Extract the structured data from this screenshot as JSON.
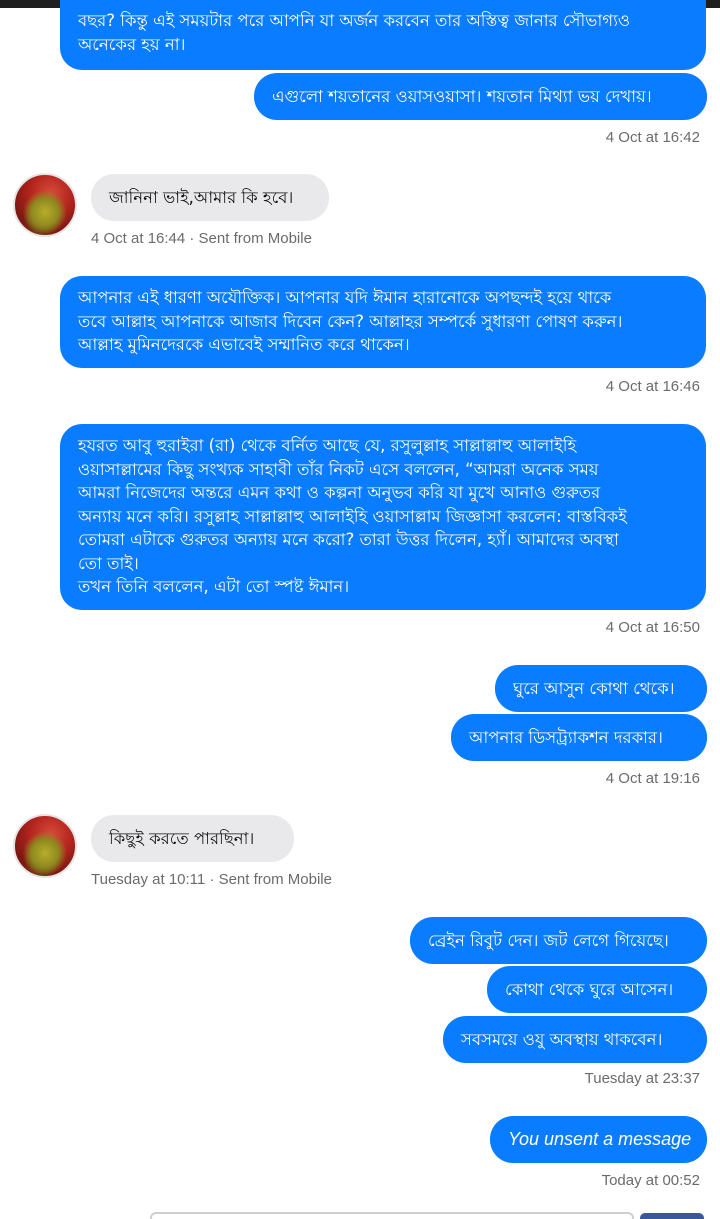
{
  "messages": {
    "m1": "বছর? কিন্তু এই সময়টার পরে আপনি যা অর্জন করবেন তার অস্তিত্ব জানার সৌভাগ্যও\nঅনেকের হয় না।",
    "m2": "এগুলো শয়তানের ওয়াসওয়াসা। শয়তান মিথ্যা ভয় দেখায়।",
    "t1": "4 Oct at 16:42",
    "r1": "জানিনা ভাই,আমার কি হবে।",
    "t2": "4 Oct at 16:44 · Sent from Mobile",
    "m3": "আপনার এই ধারণা অযৌক্তিক। আপনার যদি ঈমান হারানোকে অপছন্দই হয়ে থাকে\nতবে আল্লাহ আপনাকে আজাব দিবেন কেন? আল্লাহর সম্পর্কে সুধারণা পোষণ করুন।\nআল্লাহ মুমিনদেরকে এভাবেই সম্মানিত করে থাকেন।",
    "t3": "4 Oct at 16:46",
    "m4": "হযরত আবু হুরাইরা (রা) থেকে বর্নিত আছে যে, রসুলুল্লাহ সাল্লাল্লাহু আলাইহি\nওয়াসাল্লামের কিছু সংখ্যক সাহাবী তাঁর নিকট এসে বললেন, “আমরা অনেক সময়\nআমরা নিজেদের অন্তরে এমন কথা ও কল্পনা অনুভব করি যা মুখে আনাও গুরুতর\nঅন্যায় মনে করি। রসুল্লাহ সাল্লাল্লাহু আলাইহি ওয়াসাল্লাম জিজ্ঞাসা করলেন: বাস্তবিকই\nতোমরা এটাকে গুরুতর অন্যায় মনে করো? তারা উত্তর দিলেন, হ্যাঁ। আমাদের অবস্থা\nতো তাই।\n তখন তিনি বললেন, এটা তো স্পষ্ট ঈমান।",
    "t4": "4 Oct at 16:50",
    "m5": "ঘুরে আসুন কোথা থেকে।",
    "m6": "আপনার ডিসট্র্যাকশন দরকার।",
    "t5": "4 Oct at 19:16",
    "r2": "কিছুই করতে পারছিনা।",
    "t6": "Tuesday at 10:11 · Sent from Mobile",
    "m7": "ব্রেইন রিবুট দেন। জট লেগে গিয়েছে।",
    "m8": "কোথা থেকে ঘুরে আসেন।",
    "m9": "সবসময়ে ওযু অবস্থায় থাকবেন।",
    "t7": "Tuesday at 23:37",
    "m10": "You unsent a message",
    "t8": "Today at 00:52"
  },
  "colors": {
    "sent_bubble": "#0a7cff",
    "received_bubble": "#e9e9eb",
    "timestamp": "#6b6b6b"
  },
  "icons": {
    "contact_avatar": "avatar"
  }
}
